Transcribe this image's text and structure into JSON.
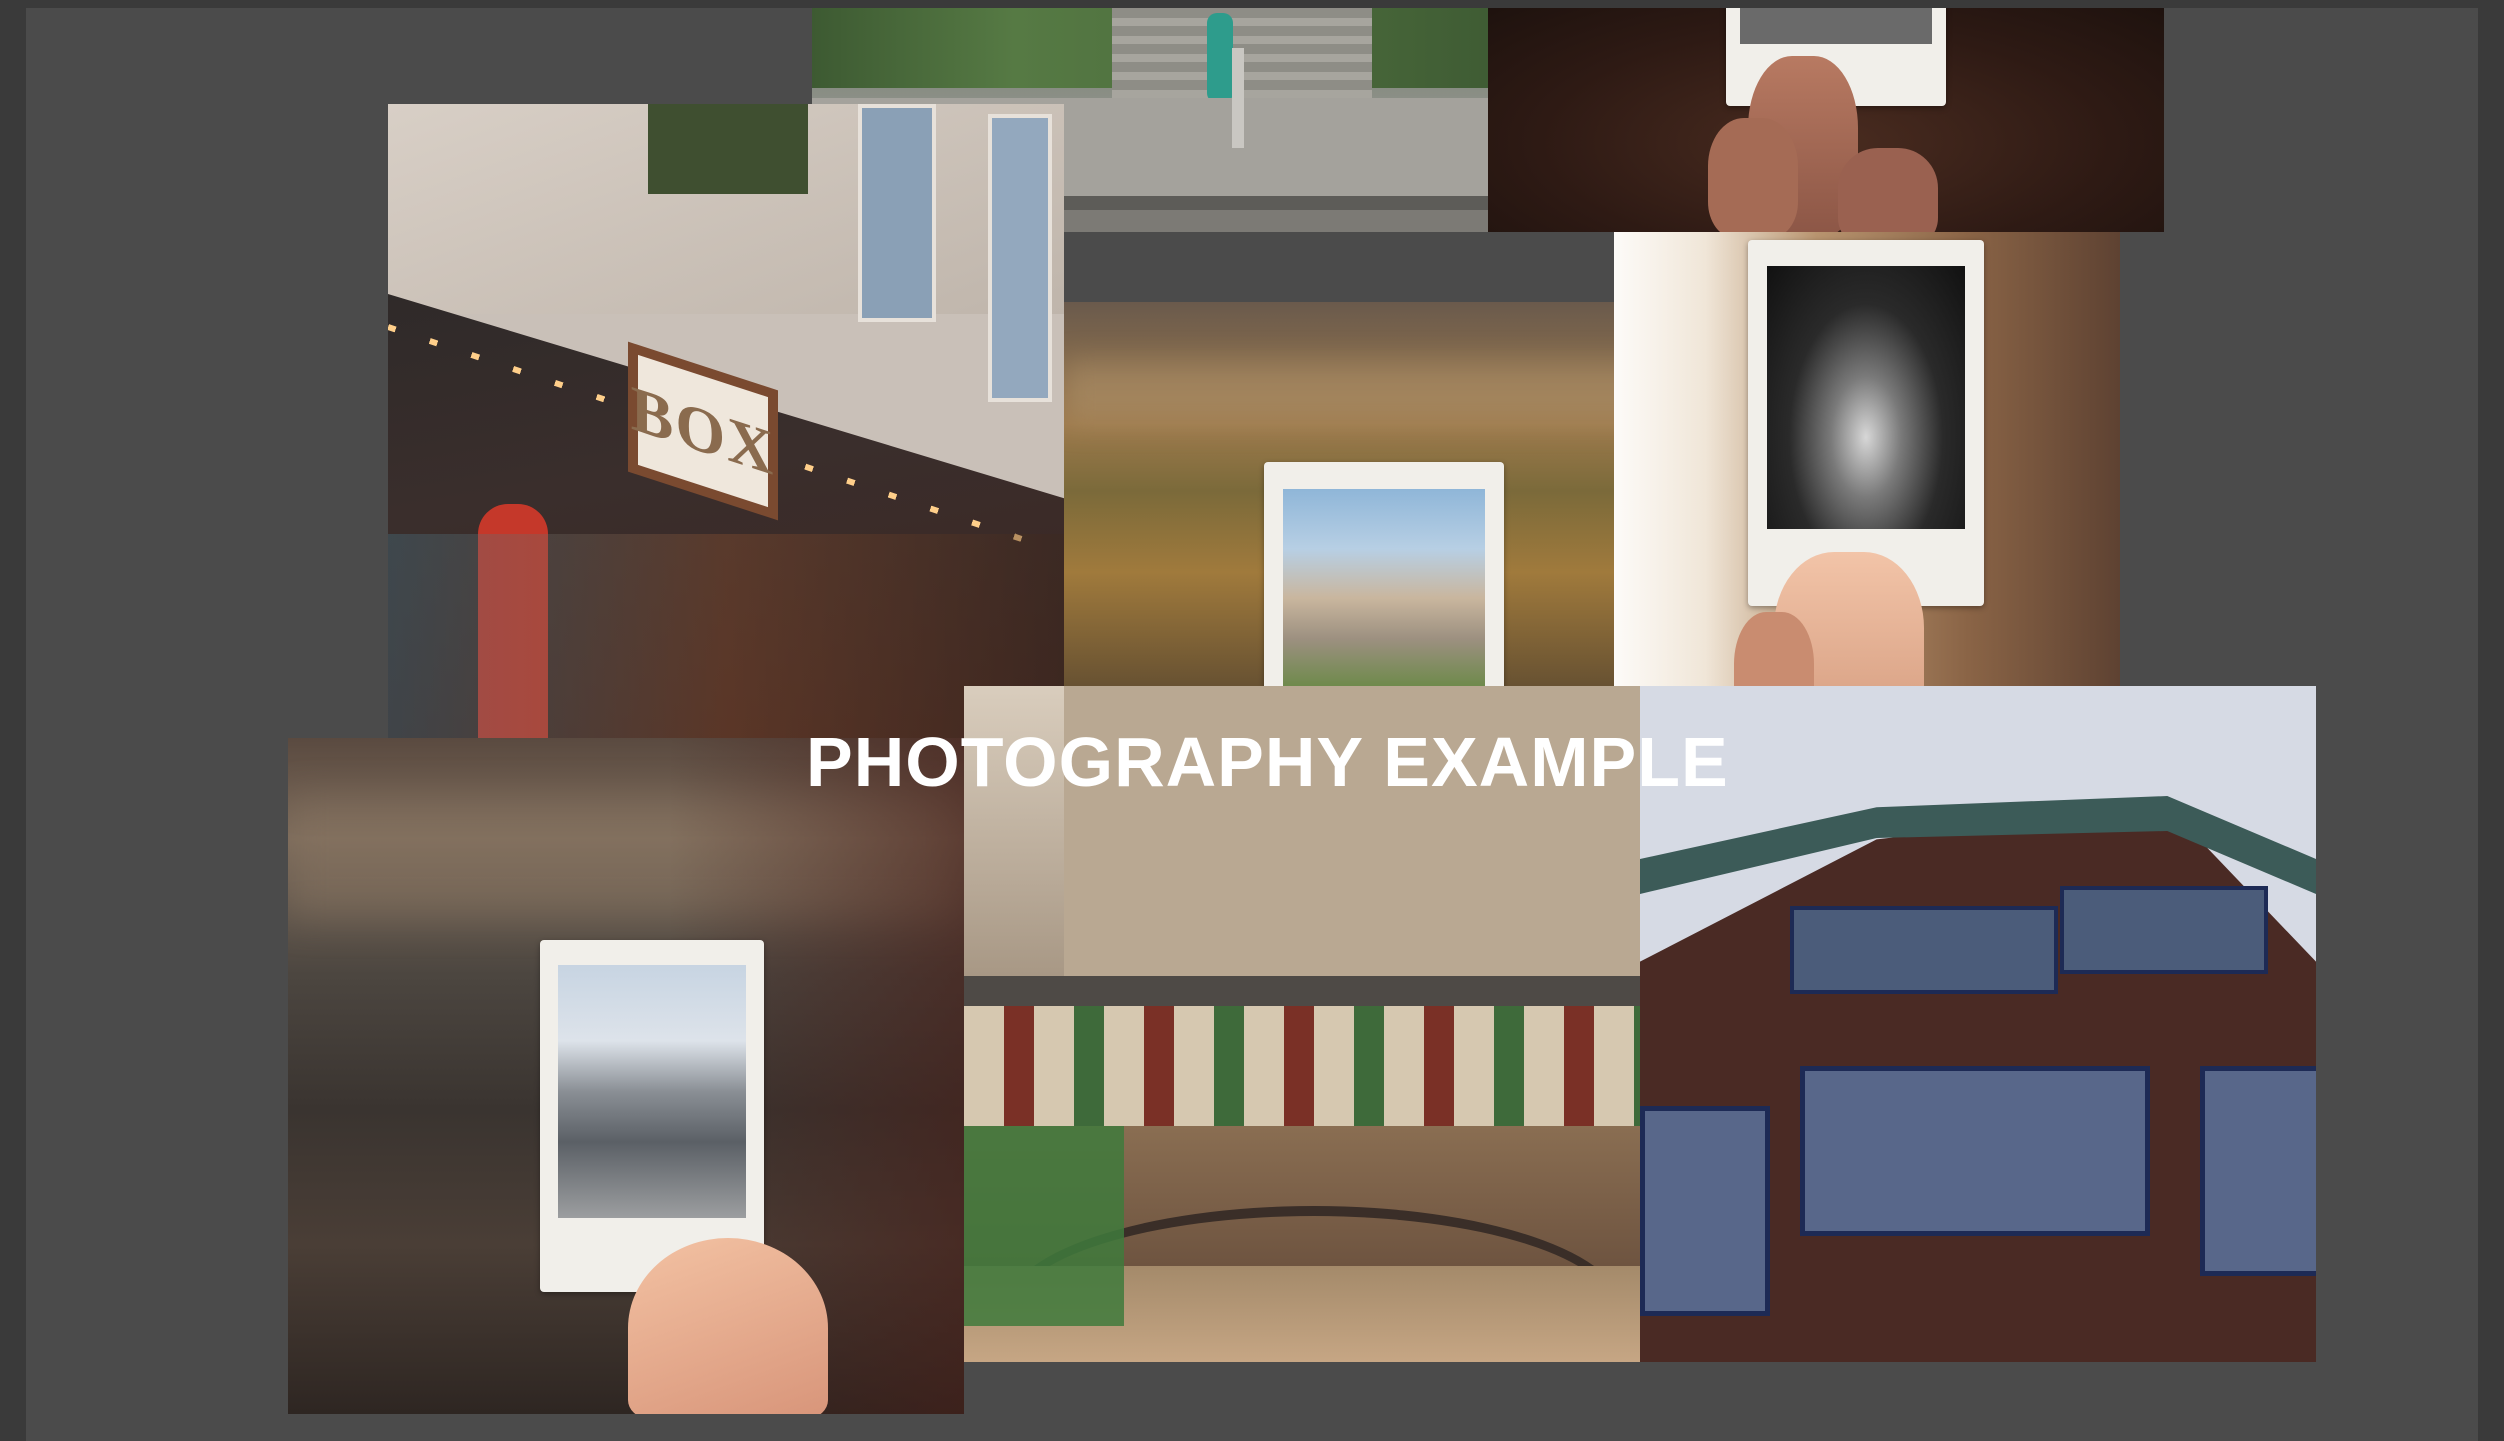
{
  "collage": {
    "title": "PHOTOGRAPHY EXAMPLE",
    "sign_text": "BOX",
    "photos": [
      {
        "name": "street-steps-photo"
      },
      {
        "name": "hand-polaroid-top-photo"
      },
      {
        "name": "box-building-photo"
      },
      {
        "name": "polaroid-canal-blur-photo"
      },
      {
        "name": "polaroid-tunnel-bw-photo"
      },
      {
        "name": "polaroid-river-photo"
      },
      {
        "name": "market-hall-photo"
      },
      {
        "name": "brick-building-photo"
      }
    ]
  }
}
